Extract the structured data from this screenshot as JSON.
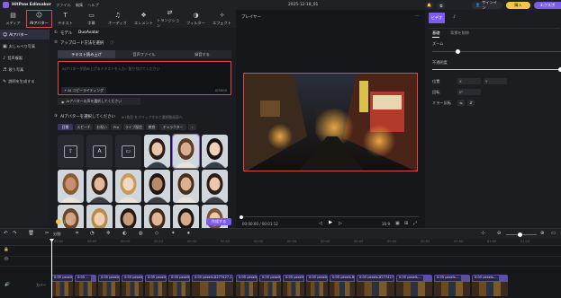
{
  "titlebar": {
    "app_name": "HitPaw Edimakor",
    "menus": [
      "ファイル",
      "編集",
      "ヘルプ"
    ],
    "doc_title": "2025-12-18_01",
    "signin": "サインイン",
    "purchase": "購入",
    "export": "エクスポ"
  },
  "tabs": [
    {
      "label": "メディア",
      "icon": "media-icon"
    },
    {
      "label": "AIアバター",
      "icon": "avatar-icon"
    },
    {
      "label": "テキスト",
      "icon": "text-icon"
    },
    {
      "label": "字幕",
      "icon": "subtitle-icon"
    },
    {
      "label": "オーディオ",
      "icon": "audio-icon"
    },
    {
      "label": "エレメント",
      "icon": "element-icon"
    },
    {
      "label": "トランジション",
      "icon": "transition-icon"
    },
    {
      "label": "フィルター",
      "icon": "filter-icon"
    },
    {
      "label": "エフェクト",
      "icon": "effect-icon"
    }
  ],
  "sidebar": {
    "items": [
      {
        "label": "AIアバター",
        "icon": "avatar-icon"
      },
      {
        "label": "おしゃべり写真",
        "icon": "photo-icon"
      },
      {
        "label": "音声複製",
        "icon": "voice-icon"
      },
      {
        "label": "歌う写真",
        "icon": "sing-icon"
      },
      {
        "label": "説明を生成する",
        "icon": "generate-icon"
      }
    ]
  },
  "panel": {
    "model_label": "モデル",
    "model_value": "DuoAvatar",
    "upload_title": "アップロード方法を選択",
    "source_tabs": [
      "テキスト読み上げ",
      "音声ファイル",
      "録音する"
    ],
    "script_placeholder": "AIアバターが読み上げるテキストを入力／貼り付けてください",
    "copywriting_label": "AI コピーライティング",
    "char_count": "0/5000",
    "voice_chip": "AIアバターの声を選択してください",
    "choose_title": "AIアバターを選択してください",
    "choose_hint": "※1枚目 をクリックすると選択肢画面へ",
    "categories": [
      "日常",
      "スピーチ",
      "お祝い",
      "Pro",
      "ライブ配信",
      "教育",
      "キャラクター"
    ],
    "credits": "1/50",
    "create_button": "作成する"
  },
  "player": {
    "title": "プレイヤー",
    "time": "00:00:00 / 00:01:12",
    "ratio": "16:9"
  },
  "inspector": {
    "tabs": [
      "ビデオ",
      "オーディオ"
    ],
    "subtabs": [
      "基礎",
      "背景を削除"
    ],
    "zoom_label": "ズーム",
    "opacity_label": "不透明度",
    "position_label": "位置",
    "rotate_label": "回転",
    "mirror_label": "ミラー反転",
    "x_label": "X",
    "y_label": "Y",
    "rotate_value": "0°"
  },
  "timeline": {
    "split_label": "分割",
    "ruler": [
      "00:00",
      "00:05",
      "00:10",
      "00:15",
      "00:20",
      "00:25",
      "00:30",
      "00:35",
      "00:40",
      "00:45",
      "00:50",
      "00:55",
      "01:00",
      "01:05",
      "01:10"
    ],
    "cover_label": "カバー",
    "clips": [
      "0:05 pexels-...",
      "0:05 ...",
      "0:05 pexels-...",
      "0:05 pexels-...",
      "0:05 pexels-...",
      "0:05 pexels-8277427-1...",
      "0:05 pexels-...",
      "0:05 pexels-...",
      "0:05 pexels-8277427-1...",
      "0:05 pexels-8277427-1...",
      "0:05 pexels-...",
      "0:05 pexels-..."
    ]
  },
  "colors": {
    "accent": "#8b5cf6",
    "highlight": "#e04848",
    "export": "#7c5cf0",
    "purchase": "#f3c64b"
  }
}
